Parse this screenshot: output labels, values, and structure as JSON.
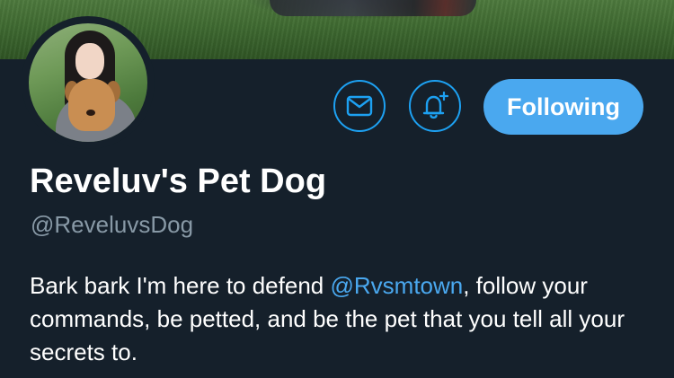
{
  "profile": {
    "display_name": "Reveluv's Pet Dog",
    "handle": "@ReveluvsDog",
    "bio": {
      "before": "Bark bark I'm here to defend ",
      "mention": "@Rvsmtown",
      "after": ", follow your commands, be petted, and be the pet that you tell all your secrets to."
    }
  },
  "actions": {
    "message_icon": "envelope-icon",
    "notify_icon": "bell-plus-icon",
    "follow_label": "Following"
  },
  "colors": {
    "background": "#15202b",
    "accent": "#1da1f2",
    "button_fill": "#4aa8ef",
    "secondary_text": "#8899a6",
    "primary_text": "#ffffff"
  }
}
